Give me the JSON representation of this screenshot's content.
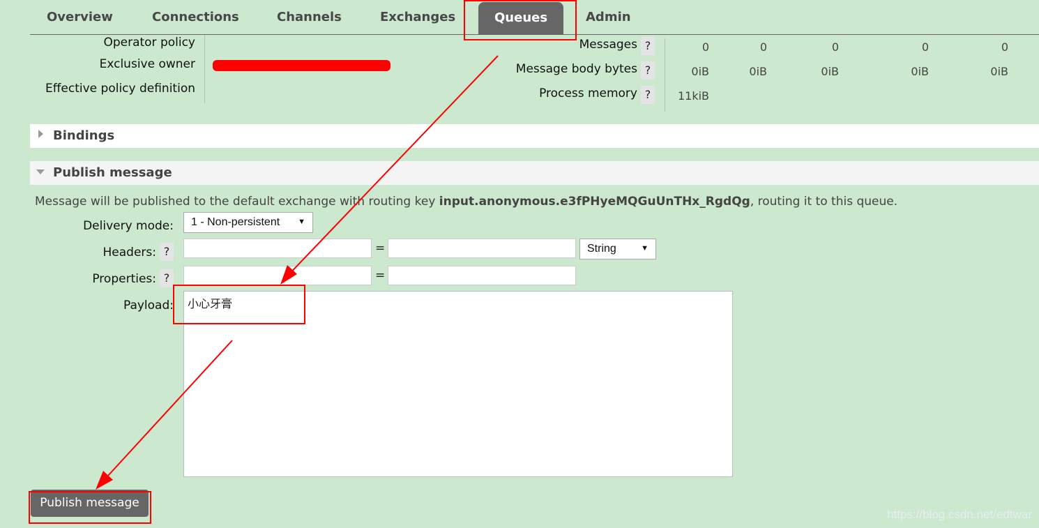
{
  "nav": {
    "tabs": [
      "Overview",
      "Connections",
      "Channels",
      "Exchanges",
      "Queues",
      "Admin"
    ],
    "active": "Queues"
  },
  "details": {
    "labels": [
      "Operator policy",
      "Exclusive owner",
      "Effective policy definition"
    ]
  },
  "stats": {
    "rows": [
      {
        "label": "Messages",
        "values": [
          "0",
          "0",
          "0",
          "0",
          "0"
        ]
      },
      {
        "label": "Message body bytes",
        "values": [
          "0iB",
          "0iB",
          "0iB",
          "0iB",
          "0iB"
        ]
      },
      {
        "label": "Process memory",
        "values": [
          "11kiB"
        ]
      }
    ],
    "help": "?"
  },
  "bindings": {
    "title": "Bindings"
  },
  "publish": {
    "title": "Publish message",
    "info_prefix": "Message will be published to the default exchange with routing key ",
    "routing_key": "input.anonymous.e3fPHyeMQGuUnTHx_RgdQg",
    "info_suffix": ", routing it to this queue.",
    "delivery_label": "Delivery mode:",
    "delivery_value": "1 - Non-persistent",
    "headers_label": "Headers:",
    "headers_type": "String",
    "properties_label": "Properties:",
    "eq": "=",
    "payload_label": "Payload:",
    "payload_value": "小心牙膏",
    "button": "Publish message"
  },
  "watermark": "https://blog.csdn.net/edtwar",
  "colors": {
    "background": "#cce8cf",
    "active_tab": "#666666",
    "annotation": "#ff0000"
  }
}
